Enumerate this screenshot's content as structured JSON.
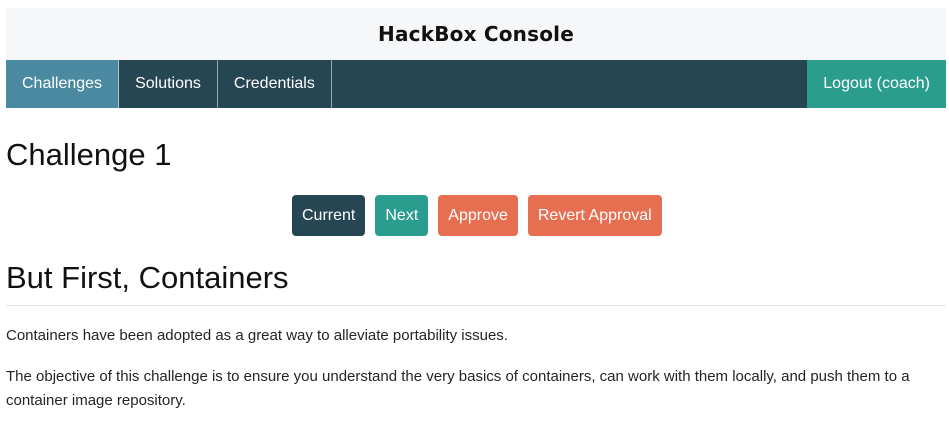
{
  "header": {
    "title": "HackBox Console"
  },
  "nav": {
    "items": [
      {
        "label": "Challenges",
        "active": true
      },
      {
        "label": "Solutions",
        "active": false
      },
      {
        "label": "Credentials",
        "active": false
      }
    ],
    "logout_label": "Logout (coach)"
  },
  "challenge": {
    "title": "Challenge 1"
  },
  "actions": {
    "current_label": "Current",
    "next_label": "Next",
    "approve_label": "Approve",
    "revert_label": "Revert Approval"
  },
  "content": {
    "heading": "But First, Containers",
    "paragraphs": [
      "Containers have been adopted as a great way to alleviate portability issues.",
      "The objective of this challenge is to ensure you understand the very basics of containers, can work with them locally, and push them to a container image repository."
    ]
  },
  "colors": {
    "nav_dark": "#264653",
    "nav_active": "#4a89a0",
    "teal": "#2a9d8f",
    "coral": "#e76f51"
  }
}
